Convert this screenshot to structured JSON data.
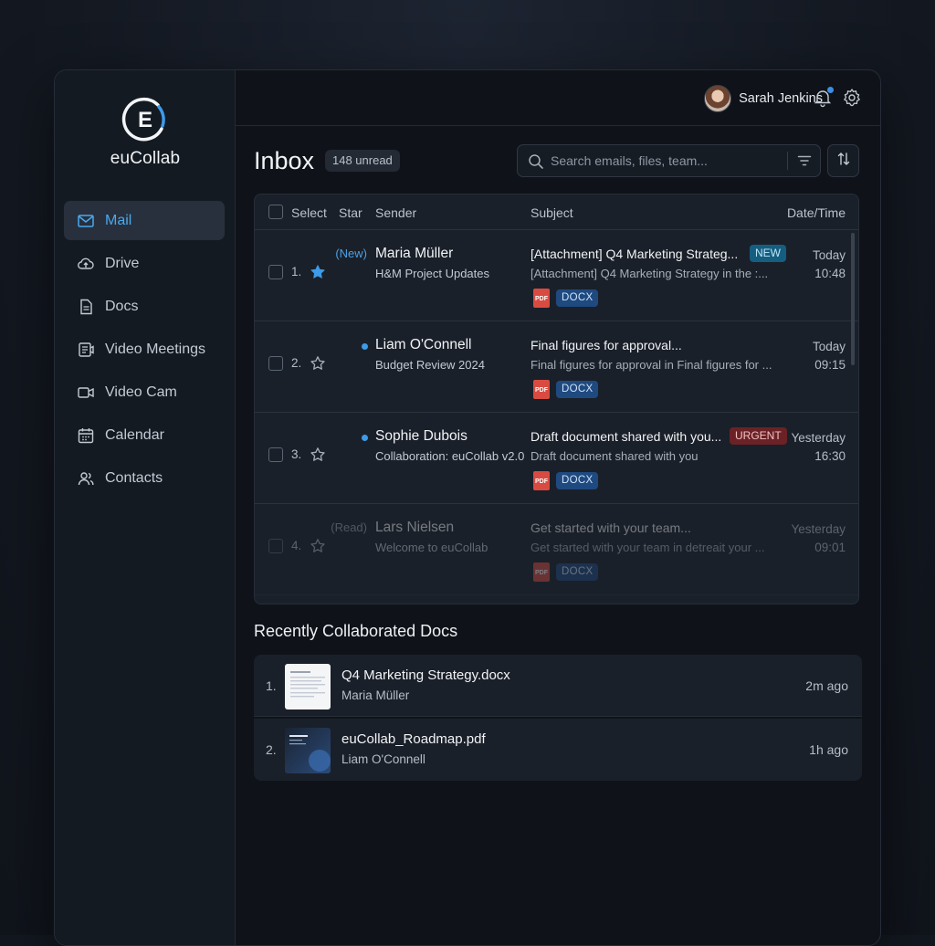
{
  "app": {
    "name": "euCollab",
    "logo_letter": "E"
  },
  "sidebar": {
    "items": [
      {
        "label": "Mail",
        "icon": "mail-icon",
        "active": true
      },
      {
        "label": "Drive",
        "icon": "cloud-upload-icon"
      },
      {
        "label": "Docs",
        "icon": "document-icon"
      },
      {
        "label": "Video Meetings",
        "icon": "video-meetings-icon"
      },
      {
        "label": "Video Cam",
        "icon": "video-camera-icon"
      },
      {
        "label": "Calendar",
        "icon": "calendar-icon"
      },
      {
        "label": "Contacts",
        "icon": "contacts-icon"
      }
    ]
  },
  "header": {
    "user_name": "Sarah Jenkins"
  },
  "inbox": {
    "title": "Inbox",
    "unread": "148 unread",
    "search_placeholder": "Search emails, files, team...",
    "columns": {
      "select": "Select",
      "star": "Star",
      "sender": "Sender",
      "subject": "Subject",
      "date": "Date/Time"
    },
    "rows": [
      {
        "num": "1.",
        "starred": true,
        "tag": "(New)",
        "sender": "Maria Müller",
        "group": "H&M Project Updates",
        "subject": "[Attachment] Q4 Marketing Strateg...",
        "badge": "NEW",
        "preview": "[Attachment] Q4 Marketing Strategy in the :...",
        "pdf": "PDF",
        "docx": "DOCX",
        "date": "Today",
        "time": "10:48"
      },
      {
        "num": "2.",
        "starred": false,
        "sender": "Liam O'Connell",
        "group": "Budget Review 2024",
        "subject": "Final figures for approval...",
        "preview": "Final figures for approval in Final figures for ...",
        "pdf": "PDF",
        "docx": "DOCX",
        "date": "Today",
        "time": "09:15"
      },
      {
        "num": "3.",
        "starred": false,
        "sender": "Sophie Dubois",
        "group": "Collaboration: euCollab v2.0",
        "subject": "Draft document shared with you...",
        "badge": "URGENT",
        "preview": "Draft document shared with you",
        "pdf": "PDF",
        "docx": "DOCX",
        "date": "Yesterday",
        "time": "16:30"
      },
      {
        "num": "4.",
        "starred": false,
        "tag": "(Read)",
        "sender": "Lars Nielsen",
        "group": "Welcome to euCollab",
        "subject": "Get started with your team...",
        "preview": "Get started with your team in detreait your ...",
        "pdf": "PDF",
        "docx": "DOCX",
        "date": "Yesterday",
        "time": "09:01"
      }
    ]
  },
  "recent": {
    "title": "Recently Collaborated Docs",
    "docs": [
      {
        "num": "1.",
        "name": "Q4 Marketing Strategy.docx",
        "owner": "Maria Müller",
        "time": "2m ago"
      },
      {
        "num": "2.",
        "name": "euCollab_Roadmap.pdf",
        "owner": "Liam O'Connell",
        "time": "1h ago"
      }
    ]
  },
  "colors": {
    "accent": "#4aa8ef",
    "new_badge": "#155e80",
    "urgent_badge": "#6b2226",
    "pdf": "#d94b41",
    "docx": "#1f4a80"
  }
}
